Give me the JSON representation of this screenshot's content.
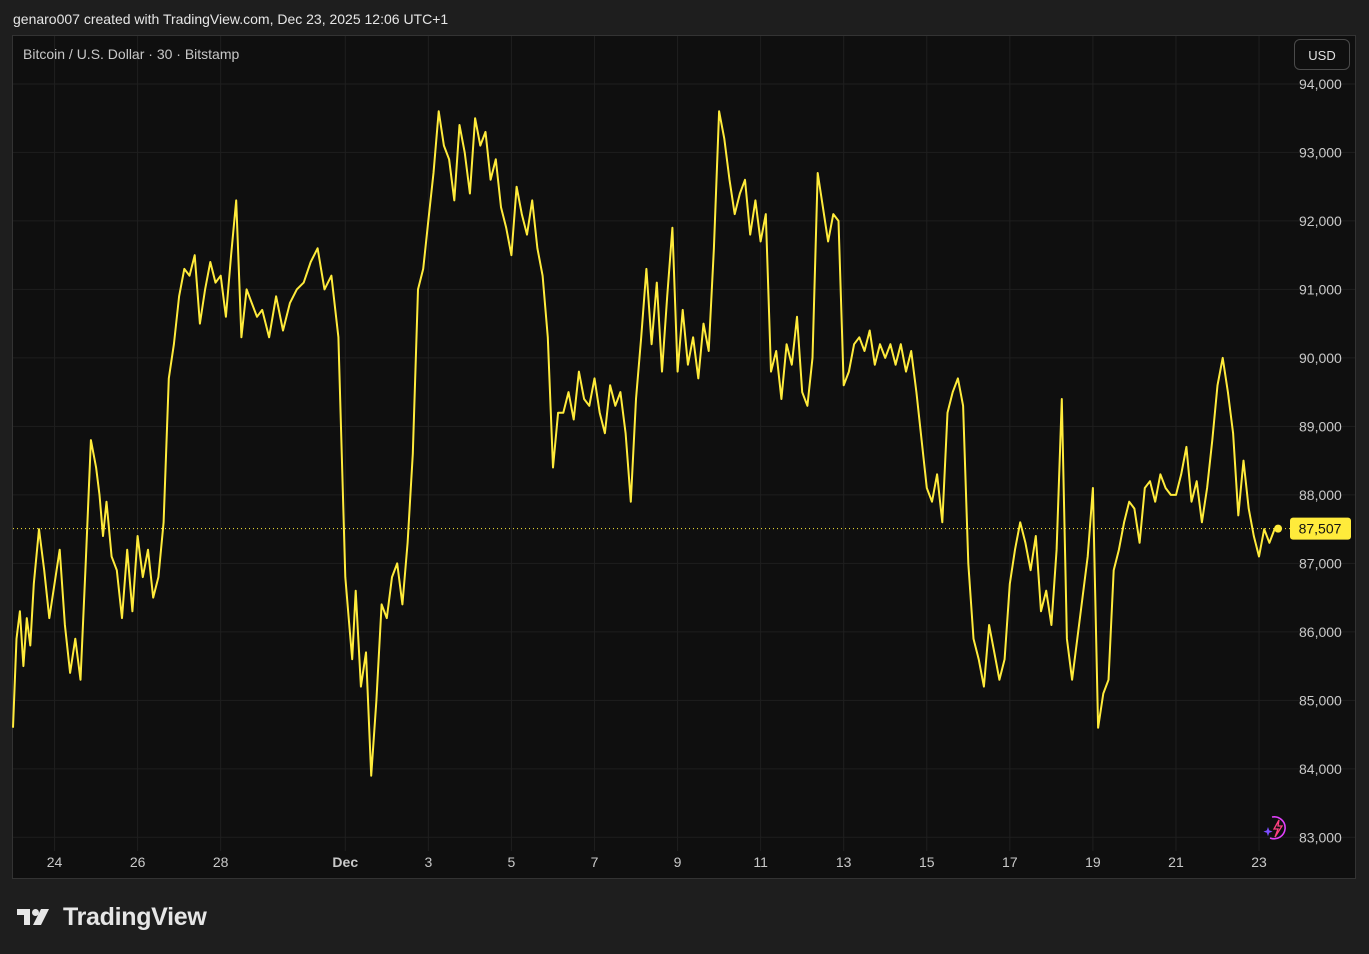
{
  "header": {
    "attribution": "genaro007 created with TradingView.com, Dec 23, 2025 12:06 UTC+1"
  },
  "symbol_label": "Bitcoin / U.S. Dollar · 30 · Bitstamp",
  "currency_button": "USD",
  "brand": {
    "name": "TradingView"
  },
  "icons": {
    "ai_assistant": "sparkle-lightning-icon",
    "logo": "tradingview-logo-icon"
  },
  "colors": {
    "line": "#ffeb3b",
    "last_price_bg": "#ffeb3b",
    "background": "#0f0f0f",
    "grid": "#1f1f1f"
  },
  "chart_data": {
    "type": "line",
    "title": "",
    "series": [
      {
        "name": "",
        "x": [
          "2025-11-23T00:00",
          "2025-11-23T02:00",
          "2025-11-23T04:00",
          "2025-11-23T06:00",
          "2025-11-23T08:00",
          "2025-11-23T10:00",
          "2025-11-23T12:00",
          "2025-11-23T15:00",
          "2025-11-23T18:00",
          "2025-11-23T21:00",
          "2025-11-24T00:00",
          "2025-11-24T03:00",
          "2025-11-24T06:00",
          "2025-11-24T09:00",
          "2025-11-24T12:00",
          "2025-11-24T15:00",
          "2025-11-24T18:00",
          "2025-11-24T21:00",
          "2025-11-25T00:00",
          "2025-11-25T02:00",
          "2025-11-25T04:00",
          "2025-11-25T06:00",
          "2025-11-25T09:00",
          "2025-11-25T12:00",
          "2025-11-25T15:00",
          "2025-11-25T18:00",
          "2025-11-25T21:00",
          "2025-11-26T00:00",
          "2025-11-26T03:00",
          "2025-11-26T06:00",
          "2025-11-26T09:00",
          "2025-11-26T12:00",
          "2025-11-26T15:00",
          "2025-11-26T18:00",
          "2025-11-26T21:00",
          "2025-11-27T00:00",
          "2025-11-27T03:00",
          "2025-11-27T06:00",
          "2025-11-27T09:00",
          "2025-11-27T12:00",
          "2025-11-27T15:00",
          "2025-11-27T18:00",
          "2025-11-27T21:00",
          "2025-11-28T00:00",
          "2025-11-28T03:00",
          "2025-11-28T06:00",
          "2025-11-28T09:00",
          "2025-11-28T12:00",
          "2025-11-28T15:00",
          "2025-11-28T18:00",
          "2025-11-28T21:00",
          "2025-11-29T00:00",
          "2025-11-29T04:00",
          "2025-11-29T08:00",
          "2025-11-29T12:00",
          "2025-11-29T16:00",
          "2025-11-29T20:00",
          "2025-11-30T00:00",
          "2025-11-30T04:00",
          "2025-11-30T08:00",
          "2025-11-30T12:00",
          "2025-11-30T16:00",
          "2025-11-30T20:00",
          "2025-12-01T00:00",
          "2025-12-01T02:00",
          "2025-12-01T04:00",
          "2025-12-01T06:00",
          "2025-12-01T09:00",
          "2025-12-01T12:00",
          "2025-12-01T15:00",
          "2025-12-01T18:00",
          "2025-12-01T21:00",
          "2025-12-02T00:00",
          "2025-12-02T03:00",
          "2025-12-02T06:00",
          "2025-12-02T09:00",
          "2025-12-02T12:00",
          "2025-12-02T15:00",
          "2025-12-02T18:00",
          "2025-12-02T21:00",
          "2025-12-03T00:00",
          "2025-12-03T03:00",
          "2025-12-03T06:00",
          "2025-12-03T09:00",
          "2025-12-03T12:00",
          "2025-12-03T15:00",
          "2025-12-03T18:00",
          "2025-12-03T21:00",
          "2025-12-04T00:00",
          "2025-12-04T03:00",
          "2025-12-04T06:00",
          "2025-12-04T09:00",
          "2025-12-04T12:00",
          "2025-12-04T15:00",
          "2025-12-04T18:00",
          "2025-12-04T21:00",
          "2025-12-05T00:00",
          "2025-12-05T03:00",
          "2025-12-05T06:00",
          "2025-12-05T09:00",
          "2025-12-05T12:00",
          "2025-12-05T15:00",
          "2025-12-05T18:00",
          "2025-12-05T21:00",
          "2025-12-06T00:00",
          "2025-12-06T03:00",
          "2025-12-06T06:00",
          "2025-12-06T09:00",
          "2025-12-06T12:00",
          "2025-12-06T15:00",
          "2025-12-06T18:00",
          "2025-12-06T21:00",
          "2025-12-07T00:00",
          "2025-12-07T03:00",
          "2025-12-07T06:00",
          "2025-12-07T09:00",
          "2025-12-07T12:00",
          "2025-12-07T15:00",
          "2025-12-07T18:00",
          "2025-12-07T21:00",
          "2025-12-08T00:00",
          "2025-12-08T03:00",
          "2025-12-08T06:00",
          "2025-12-08T09:00",
          "2025-12-08T12:00",
          "2025-12-08T15:00",
          "2025-12-08T18:00",
          "2025-12-08T21:00",
          "2025-12-09T00:00",
          "2025-12-09T03:00",
          "2025-12-09T06:00",
          "2025-12-09T09:00",
          "2025-12-09T12:00",
          "2025-12-09T15:00",
          "2025-12-09T18:00",
          "2025-12-09T21:00",
          "2025-12-10T00:00",
          "2025-12-10T03:00",
          "2025-12-10T06:00",
          "2025-12-10T09:00",
          "2025-12-10T12:00",
          "2025-12-10T15:00",
          "2025-12-10T18:00",
          "2025-12-10T21:00",
          "2025-12-11T00:00",
          "2025-12-11T03:00",
          "2025-12-11T06:00",
          "2025-12-11T09:00",
          "2025-12-11T12:00",
          "2025-12-11T15:00",
          "2025-12-11T18:00",
          "2025-12-11T21:00",
          "2025-12-12T00:00",
          "2025-12-12T03:00",
          "2025-12-12T06:00",
          "2025-12-12T09:00",
          "2025-12-12T12:00",
          "2025-12-12T15:00",
          "2025-12-12T18:00",
          "2025-12-12T21:00",
          "2025-12-13T00:00",
          "2025-12-13T03:00",
          "2025-12-13T06:00",
          "2025-12-13T09:00",
          "2025-12-13T12:00",
          "2025-12-13T15:00",
          "2025-12-13T18:00",
          "2025-12-13T21:00",
          "2025-12-14T00:00",
          "2025-12-14T03:00",
          "2025-12-14T06:00",
          "2025-12-14T09:00",
          "2025-12-14T12:00",
          "2025-12-14T15:00",
          "2025-12-14T18:00",
          "2025-12-14T21:00",
          "2025-12-15T00:00",
          "2025-12-15T03:00",
          "2025-12-15T06:00",
          "2025-12-15T09:00",
          "2025-12-15T12:00",
          "2025-12-15T15:00",
          "2025-12-15T18:00",
          "2025-12-15T21:00",
          "2025-12-16T00:00",
          "2025-12-16T03:00",
          "2025-12-16T06:00",
          "2025-12-16T09:00",
          "2025-12-16T12:00",
          "2025-12-16T15:00",
          "2025-12-16T18:00",
          "2025-12-16T21:00",
          "2025-12-17T00:00",
          "2025-12-17T03:00",
          "2025-12-17T06:00",
          "2025-12-17T09:00",
          "2025-12-17T12:00",
          "2025-12-17T15:00",
          "2025-12-17T18:00",
          "2025-12-17T21:00",
          "2025-12-18T00:00",
          "2025-12-18T03:00",
          "2025-12-18T06:00",
          "2025-12-18T09:00",
          "2025-12-18T12:00",
          "2025-12-18T15:00",
          "2025-12-18T18:00",
          "2025-12-18T21:00",
          "2025-12-19T00:00",
          "2025-12-19T03:00",
          "2025-12-19T06:00",
          "2025-12-19T09:00",
          "2025-12-19T12:00",
          "2025-12-19T15:00",
          "2025-12-19T18:00",
          "2025-12-19T21:00",
          "2025-12-20T00:00",
          "2025-12-20T03:00",
          "2025-12-20T06:00",
          "2025-12-20T09:00",
          "2025-12-20T12:00",
          "2025-12-20T15:00",
          "2025-12-20T18:00",
          "2025-12-20T21:00",
          "2025-12-21T00:00",
          "2025-12-21T03:00",
          "2025-12-21T06:00",
          "2025-12-21T09:00",
          "2025-12-21T12:00",
          "2025-12-21T15:00",
          "2025-12-21T18:00",
          "2025-12-21T21:00",
          "2025-12-22T00:00",
          "2025-12-22T03:00",
          "2025-12-22T06:00",
          "2025-12-22T09:00",
          "2025-12-22T12:00",
          "2025-12-22T15:00",
          "2025-12-22T18:00",
          "2025-12-22T21:00",
          "2025-12-23T00:00",
          "2025-12-23T03:00",
          "2025-12-23T06:00",
          "2025-12-23T09:00",
          "2025-12-23T11:00"
        ],
        "values": [
          84600,
          85900,
          86300,
          85500,
          86200,
          85800,
          86700,
          87500,
          86900,
          86200,
          86700,
          87200,
          86100,
          85400,
          85900,
          85300,
          87000,
          88800,
          88400,
          88000,
          87400,
          87900,
          87100,
          86900,
          86200,
          87200,
          86300,
          87400,
          86800,
          87200,
          86500,
          86800,
          87600,
          89700,
          90200,
          90900,
          91300,
          91200,
          91500,
          90500,
          91000,
          91400,
          91100,
          91200,
          90600,
          91500,
          92300,
          90300,
          91000,
          90800,
          90600,
          90700,
          90300,
          90900,
          90400,
          90800,
          91000,
          91100,
          91400,
          91600,
          91000,
          91200,
          90300,
          86800,
          86200,
          85600,
          86600,
          85200,
          85700,
          83900,
          85000,
          86400,
          86200,
          86800,
          87000,
          86400,
          87300,
          88600,
          91000,
          91300,
          92000,
          92700,
          93600,
          93100,
          92900,
          92300,
          93400,
          93000,
          92400,
          93500,
          93100,
          93300,
          92600,
          92900,
          92200,
          91900,
          91500,
          92500,
          92100,
          91800,
          92300,
          91600,
          91200,
          90300,
          88400,
          89200,
          89200,
          89500,
          89100,
          89800,
          89400,
          89300,
          89700,
          89200,
          88900,
          89600,
          89300,
          89500,
          88900,
          87900,
          89400,
          90300,
          91300,
          90200,
          91100,
          89800,
          90900,
          91900,
          89800,
          90700,
          89900,
          90300,
          89700,
          90500,
          90100,
          91600,
          93600,
          93200,
          92600,
          92100,
          92400,
          92600,
          91800,
          92300,
          91700,
          92100,
          89800,
          90100,
          89400,
          90200,
          89900,
          90600,
          89500,
          89300,
          90000,
          92700,
          92200,
          91700,
          92100,
          92000,
          89600,
          89800,
          90200,
          90300,
          90100,
          90400,
          89900,
          90200,
          90000,
          90200,
          89900,
          90200,
          89800,
          90100,
          89500,
          88800,
          88100,
          87900,
          88300,
          87600,
          89200,
          89500,
          89700,
          89300,
          87000,
          85900,
          85600,
          85200,
          86100,
          85700,
          85300,
          85600,
          86700,
          87200,
          87600,
          87300,
          86900,
          87400,
          86300,
          86600,
          86100,
          87200,
          89400,
          85900,
          85300,
          85900,
          86500,
          87100,
          88100,
          84600,
          85100,
          85300,
          86900,
          87200,
          87600,
          87900,
          87800,
          87300,
          88100,
          88200,
          87900,
          88300,
          88100,
          88000,
          88000,
          88300,
          88700,
          87900,
          88200,
          87600,
          88100,
          88800,
          89600,
          90000,
          89500,
          88900,
          87700,
          88500,
          87800,
          87400,
          87100,
          87500,
          87300,
          87500,
          87507
        ]
      }
    ],
    "ylabel": "",
    "xlabel": "",
    "ylim": [
      82800,
      94700
    ],
    "xlim": [
      "2025-11-23T00:00",
      "2025-12-23T15:00"
    ],
    "yticks": [
      94000,
      93000,
      92000,
      91000,
      90000,
      89000,
      88000,
      87000,
      86000,
      85000,
      84000,
      83000
    ],
    "ytick_labels": [
      "94,000",
      "93,000",
      "92,000",
      "91,000",
      "90,000",
      "89,000",
      "88,000",
      "87,000",
      "86,000",
      "85,000",
      "84,000",
      "83,000"
    ],
    "xticks": [
      {
        "label": "24",
        "date": "2025-11-24"
      },
      {
        "label": "26",
        "date": "2025-11-26"
      },
      {
        "label": "28",
        "date": "2025-11-28"
      },
      {
        "label": "Dec",
        "date": "2025-12-01"
      },
      {
        "label": "3",
        "date": "2025-12-03"
      },
      {
        "label": "5",
        "date": "2025-12-05"
      },
      {
        "label": "7",
        "date": "2025-12-07"
      },
      {
        "label": "9",
        "date": "2025-12-09"
      },
      {
        "label": "11",
        "date": "2025-12-11"
      },
      {
        "label": "13",
        "date": "2025-12-13"
      },
      {
        "label": "15",
        "date": "2025-12-15"
      },
      {
        "label": "17",
        "date": "2025-12-17"
      },
      {
        "label": "19",
        "date": "2025-12-19"
      },
      {
        "label": "21",
        "date": "2025-12-21"
      },
      {
        "label": "23",
        "date": "2025-12-23"
      }
    ],
    "last_price": 87507,
    "last_price_label": "87,507",
    "grid": true,
    "legend": "none"
  }
}
